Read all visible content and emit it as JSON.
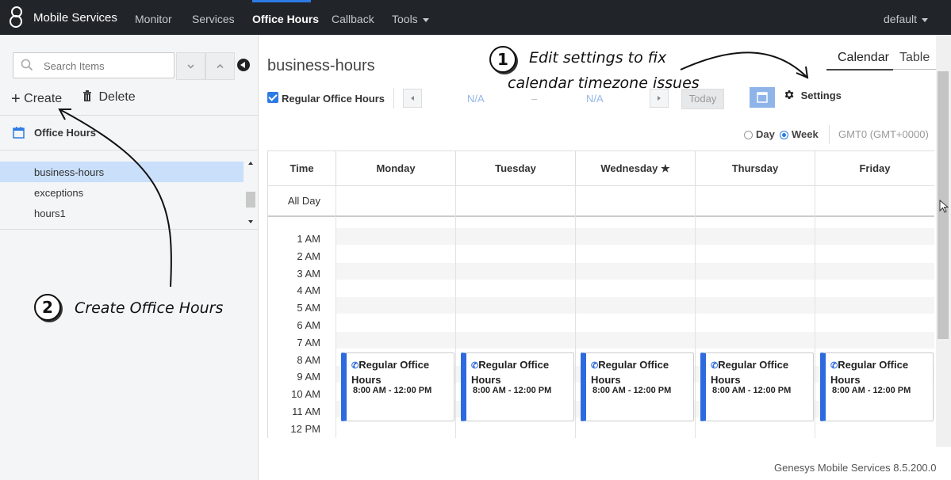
{
  "app": {
    "title": "Mobile Services"
  },
  "nav": {
    "items": [
      {
        "label": "Monitor"
      },
      {
        "label": "Services"
      },
      {
        "label": "Office Hours"
      },
      {
        "label": "Callback"
      },
      {
        "label": "Tools"
      }
    ],
    "active": "Office Hours",
    "user": "default"
  },
  "sidebar": {
    "search_placeholder": "Search Items",
    "create_label": "Create",
    "delete_label": "Delete",
    "section_label": "Office Hours",
    "items": [
      {
        "label": "business-hours",
        "selected": true
      },
      {
        "label": "exceptions"
      },
      {
        "label": "hours1"
      }
    ]
  },
  "main": {
    "title": "business-hours",
    "tabs": [
      {
        "label": "Calendar"
      },
      {
        "label": "Table"
      }
    ],
    "active_tab": "Calendar",
    "filter_label": "Regular Office Hours",
    "filter_checked": true,
    "date_start": "N/A",
    "date_sep": "–",
    "date_end": "N/A",
    "today_label": "Today",
    "settings_label": "Settings",
    "view_day": "Day",
    "view_week": "Week",
    "view_selected": "Week",
    "timezone": "GMT0 (GMT+0000)"
  },
  "calendar": {
    "time_header": "Time",
    "days": [
      "Monday",
      "Tuesday",
      "Wednesday",
      "Thursday",
      "Friday"
    ],
    "today_marker": "★",
    "all_day_label": "All Day",
    "hours": [
      "1 AM",
      "2 AM",
      "3 AM",
      "4 AM",
      "5 AM",
      "6 AM",
      "7 AM",
      "8 AM",
      "9 AM",
      "10 AM",
      "11 AM",
      "12 PM"
    ],
    "event_title": "Regular Office Hours",
    "event_time": "8:00 AM - 12:00 PM"
  },
  "annotations": {
    "one_num": "1",
    "one_line1": "Edit settings to fix",
    "one_line2": "calendar timezone issues",
    "two_num": "2",
    "two_text": "Create Office Hours"
  },
  "footer": "Genesys Mobile Services 8.5.200.0",
  "colors": {
    "nav_bg": "#212529",
    "accent": "#2d7be5",
    "event_bar": "#2d6ae0",
    "selected_row": "#c9dffa"
  }
}
